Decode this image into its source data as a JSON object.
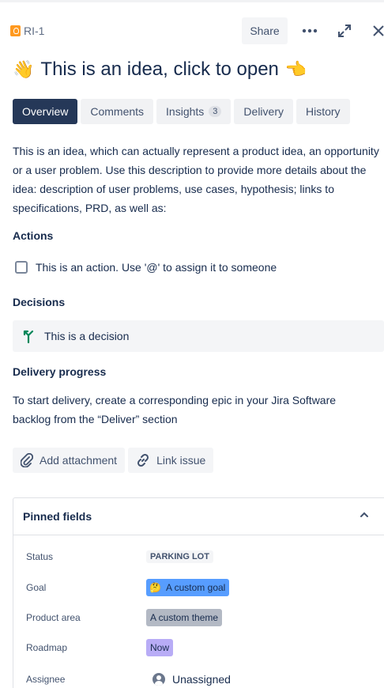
{
  "header": {
    "issue_key": "RI-1",
    "share_label": "Share"
  },
  "title": {
    "emoji_start": "👋",
    "text": "This is an idea, click to open",
    "emoji_end": "👈"
  },
  "tabs": [
    {
      "label": "Overview",
      "active": true
    },
    {
      "label": "Comments"
    },
    {
      "label": "Insights",
      "count": "3"
    },
    {
      "label": "Delivery"
    },
    {
      "label": "History"
    }
  ],
  "description": "This is an idea, which can actually represent a product idea, an opportunity or a user problem. Use this description to provide more details about the idea: description of user problems, use cases, hypothesis; links to specifications, PRD, as well as:",
  "sections": {
    "actions_title": "Actions",
    "action_text": "This is an action. Use '@' to assign it to someone",
    "decisions_title": "Decisions",
    "decision_text": "This is a decision",
    "delivery_title": "Delivery progress",
    "delivery_text": "To start delivery, create a corresponding epic in your Jira Software backlog from the “Deliver” section"
  },
  "buttons": {
    "add_attachment": "Add attachment",
    "link_issue": "Link issue"
  },
  "pinned": {
    "title": "Pinned fields",
    "fields": {
      "status_label": "Status",
      "status_value": "PARKING LOT",
      "goal_label": "Goal",
      "goal_emoji": "🤔",
      "goal_value": "A custom goal",
      "product_area_label": "Product area",
      "product_area_value": "A custom theme",
      "roadmap_label": "Roadmap",
      "roadmap_value": "Now",
      "assignee_label": "Assignee",
      "assignee_value": "Unassigned"
    }
  },
  "colors": {
    "active_tab": "#253858",
    "goal_chip": "#579dff",
    "theme_chip": "#b3b9c4",
    "roadmap_chip": "#b8acf6",
    "decision_icon": "#00875a",
    "idea_icon": "#ff991f"
  },
  "icons": [
    "idea-icon",
    "more-icon",
    "expand-icon",
    "close-icon",
    "decision-icon",
    "paperclip-icon",
    "link-icon",
    "chevron-up-icon",
    "avatar-icon"
  ]
}
